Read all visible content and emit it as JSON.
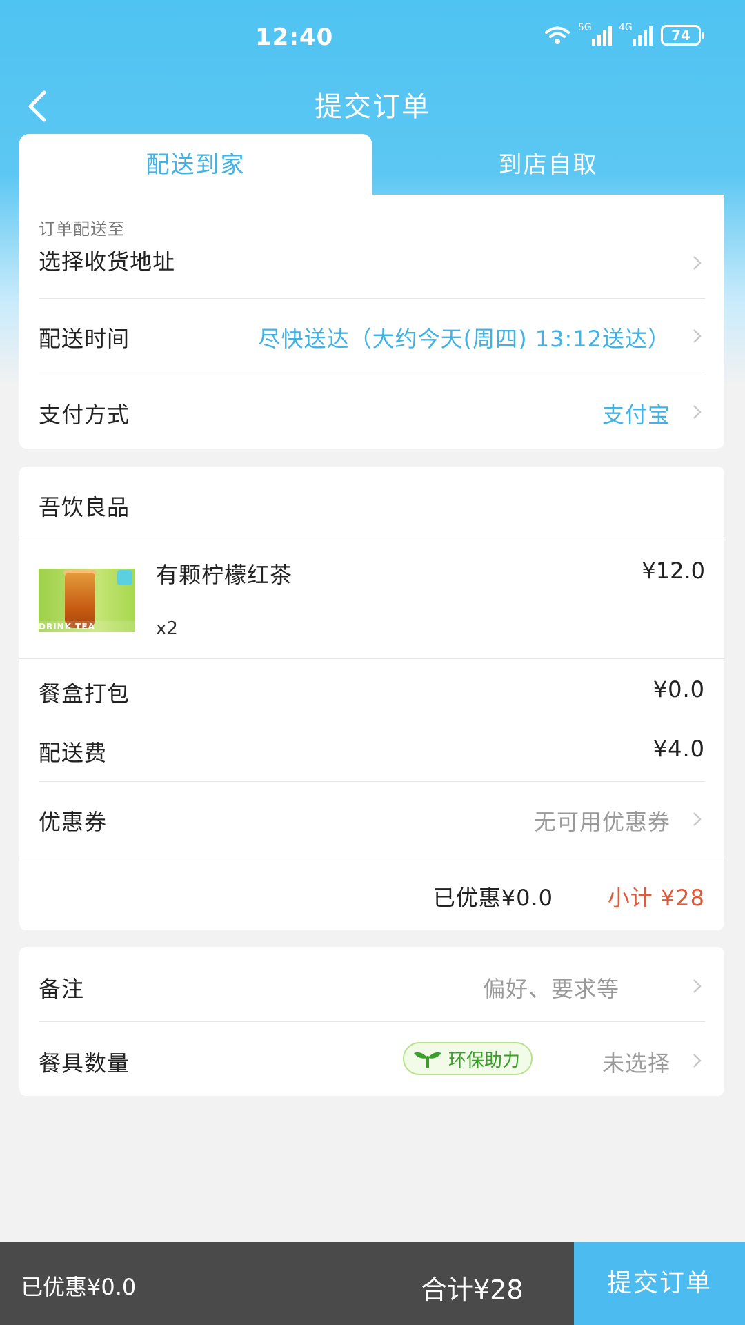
{
  "status_bar": {
    "time": "12:40",
    "battery": "74",
    "net1": "5G",
    "net2": "4G"
  },
  "nav": {
    "title": "提交订单"
  },
  "tabs": {
    "delivery": "配送到家",
    "pickup": "到店自取"
  },
  "delivery": {
    "address_label": "订单配送至",
    "address_value": "选择收货地址",
    "time_label": "配送时间",
    "time_value": "尽快送达（大约今天(周四) 13:12送达）",
    "payment_label": "支付方式",
    "payment_value": "支付宝"
  },
  "store": {
    "name": "吾饮良品",
    "item": {
      "name": "有颗柠檬红茶",
      "price": "¥12.0",
      "qty": "x2",
      "thumb_text": "DRINK TEA"
    },
    "packing_label": "餐盒打包",
    "packing_value": "¥0.0",
    "delivery_fee_label": "配送费",
    "delivery_fee_value": "¥4.0",
    "coupon_label": "优惠券",
    "coupon_value": "无可用优惠券",
    "discount_text": "已优惠¥0.0",
    "subtotal_text": "小计 ¥28"
  },
  "extras": {
    "remark_label": "备注",
    "remark_placeholder": "偏好、要求等",
    "utensils_label": "餐具数量",
    "eco_badge": "环保助力",
    "utensils_value": "未选择"
  },
  "bottom_bar": {
    "discount": "已优惠¥0.0",
    "total": "合计¥28",
    "submit": "提交订单"
  },
  "colors": {
    "accent": "#3fb3e6",
    "price_red": "#e05a3a",
    "eco_green": "#3a9e2a",
    "bar_dark": "#4a4a4a"
  }
}
